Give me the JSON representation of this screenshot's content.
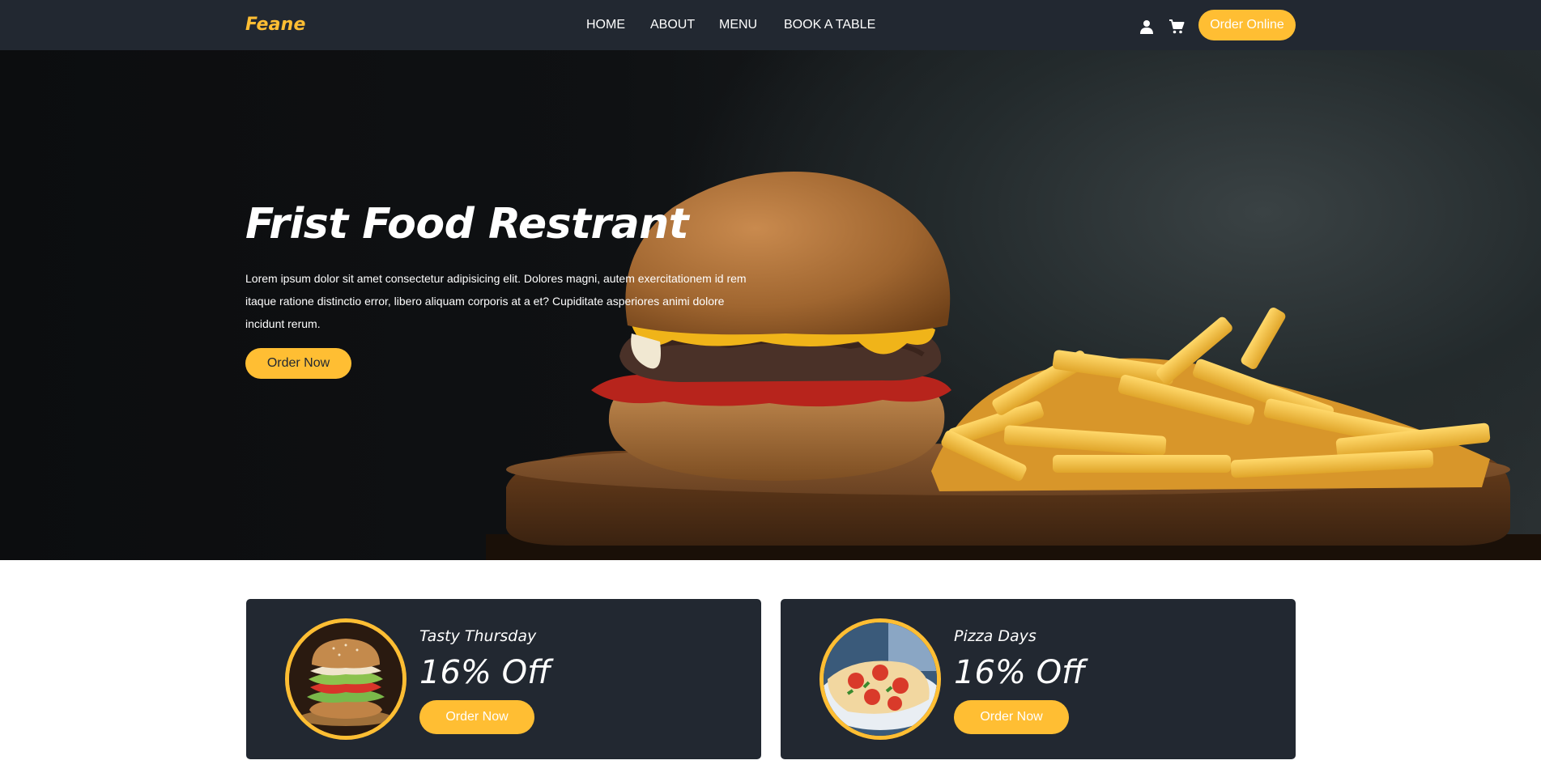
{
  "brand": {
    "name": "Feane"
  },
  "nav": {
    "items": [
      {
        "label": "Home"
      },
      {
        "label": "About"
      },
      {
        "label": "Menu"
      },
      {
        "label": "Book A Table"
      }
    ],
    "user_icon": "user-icon",
    "cart_icon": "cart-icon",
    "order_online_label": "Order Online"
  },
  "hero": {
    "title": "Frist Food Restrant",
    "description": "Lorem ipsum dolor sit amet consectetur adipisicing elit. Dolores magni, autem exercitationem id rem itaque ratione distinctio error, libero aliquam corporis at a et? Cupiditate asperiores animi dolore incidunt rerum.",
    "button_label": "Order Now"
  },
  "offers": [
    {
      "subtitle": "Tasty Thursday",
      "discount": "16% Off",
      "button_label": "Order Now"
    },
    {
      "subtitle": "Pizza Days",
      "discount": "16% Off",
      "button_label": "Order Now"
    }
  ],
  "colors": {
    "accent": "#ffbe33",
    "dark": "#222831",
    "white": "#ffffff"
  }
}
